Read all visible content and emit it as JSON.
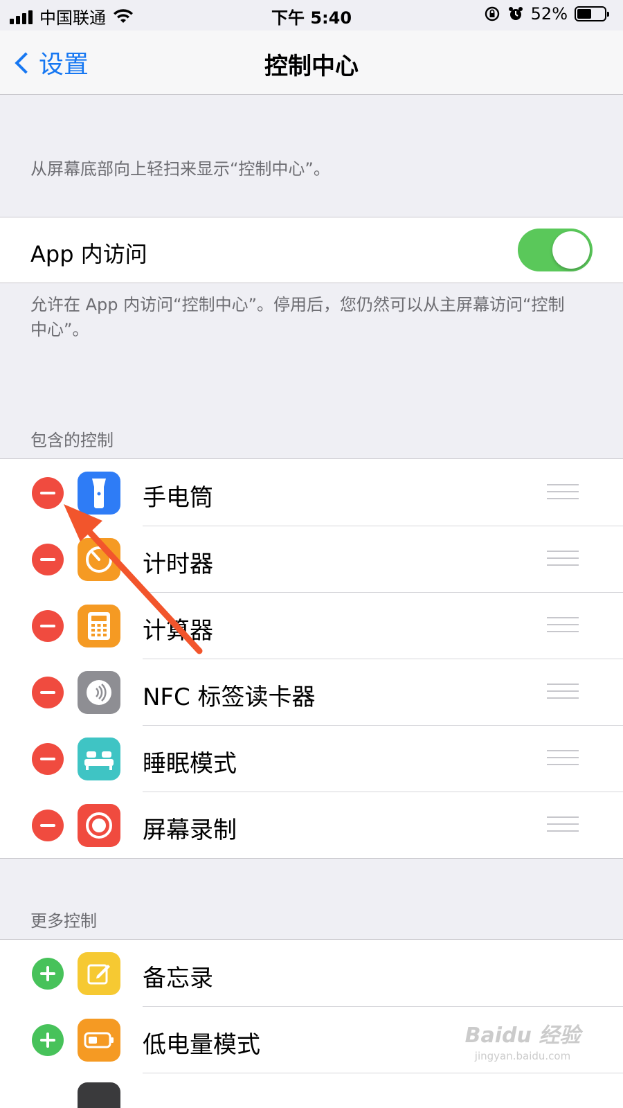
{
  "status_bar": {
    "carrier": "中国联通",
    "time": "下午 5:40",
    "battery_text": "52%",
    "battery_level": 0.52,
    "icons": [
      "signal-icon",
      "wifi-icon",
      "rotation-lock-icon",
      "alarm-icon",
      "battery-icon"
    ]
  },
  "nav": {
    "back_label": "设置",
    "title": "控制中心"
  },
  "intro_text": "从屏幕底部向上轻扫来显示“控制中心”。",
  "app_access": {
    "label": "App 内访问",
    "enabled": true,
    "description": "允许在 App 内访问“控制中心”。停用后，您仍然可以从主屏幕访问“控制中心”。"
  },
  "included_controls": {
    "header": "包含的控制",
    "items": [
      {
        "label": "手电筒",
        "icon": "flashlight-icon",
        "color": "#2e7cf6"
      },
      {
        "label": "计时器",
        "icon": "timer-icon",
        "color": "#f59a23"
      },
      {
        "label": "计算器",
        "icon": "calculator-icon",
        "color": "#f59a23"
      },
      {
        "label": "NFC 标签读卡器",
        "icon": "nfc-icon",
        "color": "#8e8e93"
      },
      {
        "label": "睡眠模式",
        "icon": "bed-icon",
        "color": "#3fc4c4"
      },
      {
        "label": "屏幕录制",
        "icon": "screen-record-icon",
        "color": "#f04b3f"
      }
    ]
  },
  "more_controls": {
    "header": "更多控制",
    "items": [
      {
        "label": "备忘录",
        "icon": "notes-icon",
        "color": "#f6c932"
      },
      {
        "label": "低电量模式",
        "icon": "low-power-icon",
        "color": "#f59a23"
      }
    ]
  },
  "watermark": {
    "logo": "Baidu 经验",
    "url": "jingyan.baidu.com"
  },
  "colors": {
    "accent_blue": "#1677f2",
    "remove_red": "#f04b3f",
    "add_green": "#47c25a",
    "toggle_green": "#5ac85a",
    "annotation_arrow": "#f2552c"
  }
}
